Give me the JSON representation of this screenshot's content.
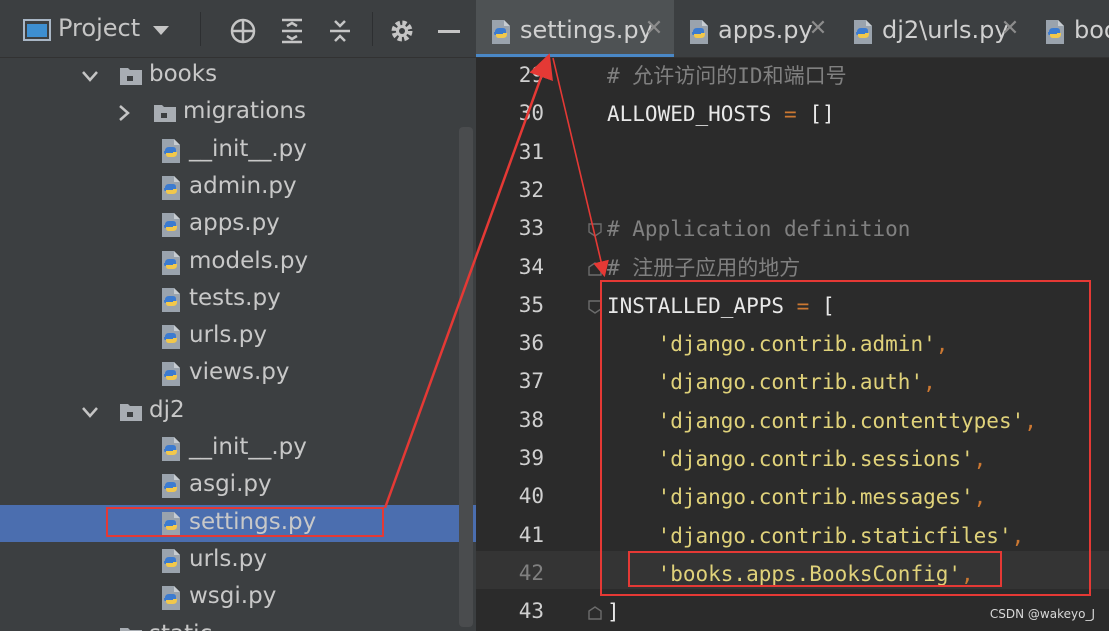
{
  "project_panel": {
    "title": "Project",
    "toolbar_icons": [
      "target-icon",
      "expand-all-icon",
      "collapse-all-icon",
      "gear-icon",
      "minimize-icon"
    ]
  },
  "tree": {
    "items": [
      {
        "label": "books",
        "type": "folder",
        "expanded": true
      },
      {
        "label": "migrations",
        "type": "folder",
        "expanded": false
      },
      {
        "label": "__init__.py",
        "type": "python-file"
      },
      {
        "label": "admin.py",
        "type": "python-file"
      },
      {
        "label": "apps.py",
        "type": "python-file"
      },
      {
        "label": "models.py",
        "type": "python-file"
      },
      {
        "label": "tests.py",
        "type": "python-file"
      },
      {
        "label": "urls.py",
        "type": "python-file"
      },
      {
        "label": "views.py",
        "type": "python-file"
      },
      {
        "label": "dj2",
        "type": "folder",
        "expanded": true
      },
      {
        "label": "__init__.py",
        "type": "python-file"
      },
      {
        "label": "asgi.py",
        "type": "python-file"
      },
      {
        "label": "settings.py",
        "type": "python-file",
        "selected": true
      },
      {
        "label": "urls.py",
        "type": "python-file"
      },
      {
        "label": "wsgi.py",
        "type": "python-file"
      },
      {
        "label": "static",
        "type": "folder",
        "expanded": true
      }
    ]
  },
  "tabs": [
    {
      "label": "settings.py",
      "active": true
    },
    {
      "label": "apps.py",
      "active": false
    },
    {
      "label": "dj2\\urls.py",
      "active": false
    },
    {
      "label": "boo",
      "active": false
    }
  ],
  "editor": {
    "lines": [
      {
        "num": "29",
        "parts": [
          {
            "t": "# 允许访问的ID和端口号",
            "c": "comment"
          }
        ]
      },
      {
        "num": "30",
        "parts": [
          {
            "t": "ALLOWED_HOSTS ",
            "c": "plain"
          },
          {
            "t": "=",
            "c": "op"
          },
          {
            "t": " []",
            "c": "plain"
          }
        ]
      },
      {
        "num": "31",
        "parts": []
      },
      {
        "num": "32",
        "parts": []
      },
      {
        "num": "33",
        "parts": [
          {
            "t": "# Application definition",
            "c": "comment"
          }
        ]
      },
      {
        "num": "34",
        "parts": [
          {
            "t": "# 注册子应用的地方",
            "c": "comment"
          }
        ]
      },
      {
        "num": "35",
        "parts": [
          {
            "t": "INSTALLED_APPS ",
            "c": "plain"
          },
          {
            "t": "=",
            "c": "op"
          },
          {
            "t": " [",
            "c": "plain"
          }
        ]
      },
      {
        "num": "36",
        "parts": [
          {
            "t": "    ",
            "c": "plain"
          },
          {
            "t": "'django.contrib.admin'",
            "c": "str"
          },
          {
            "t": ",",
            "c": "op"
          }
        ]
      },
      {
        "num": "37",
        "parts": [
          {
            "t": "    ",
            "c": "plain"
          },
          {
            "t": "'django.contrib.auth'",
            "c": "str"
          },
          {
            "t": ",",
            "c": "op"
          }
        ]
      },
      {
        "num": "38",
        "parts": [
          {
            "t": "    ",
            "c": "plain"
          },
          {
            "t": "'django.contrib.contenttypes'",
            "c": "str"
          },
          {
            "t": ",",
            "c": "op"
          }
        ]
      },
      {
        "num": "39",
        "parts": [
          {
            "t": "    ",
            "c": "plain"
          },
          {
            "t": "'django.contrib.sessions'",
            "c": "str"
          },
          {
            "t": ",",
            "c": "op"
          }
        ]
      },
      {
        "num": "40",
        "parts": [
          {
            "t": "    ",
            "c": "plain"
          },
          {
            "t": "'django.contrib.messages'",
            "c": "str"
          },
          {
            "t": ",",
            "c": "op"
          }
        ]
      },
      {
        "num": "41",
        "parts": [
          {
            "t": "    ",
            "c": "plain"
          },
          {
            "t": "'django.contrib.staticfiles'",
            "c": "str"
          },
          {
            "t": ",",
            "c": "op"
          }
        ]
      },
      {
        "num": "42",
        "parts": [
          {
            "t": "    ",
            "c": "plain"
          },
          {
            "t": "'books.apps.BooksConfig'",
            "c": "str"
          },
          {
            "t": ",",
            "c": "op"
          }
        ],
        "current": true
      },
      {
        "num": "43",
        "parts": [
          {
            "t": "]",
            "c": "plain"
          }
        ]
      }
    ]
  },
  "watermark": "CSDN @wakeyo_J",
  "colors": {
    "annotation": "#e53935",
    "selection": "#4b6eaf",
    "string": "#e0d27a",
    "keyword_op": "#cc7832",
    "comment": "#808080"
  }
}
